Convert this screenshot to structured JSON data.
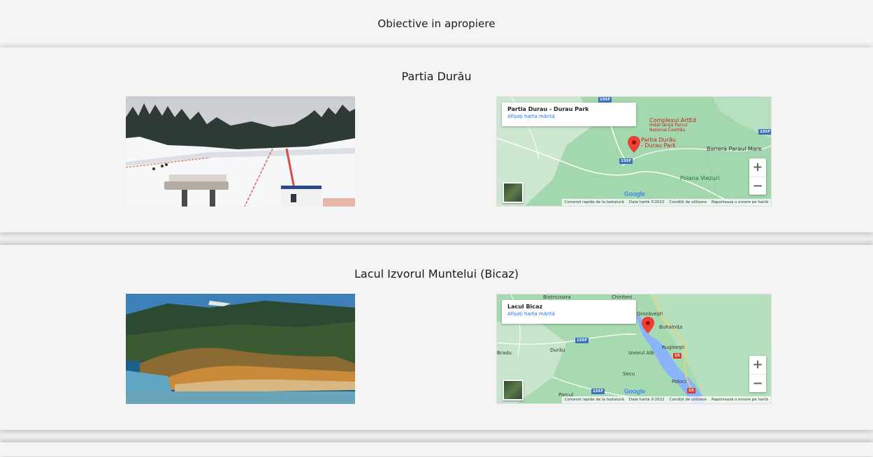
{
  "page_title": "Obiective in apropiere",
  "sections": [
    {
      "title": "Partia Durău",
      "map": {
        "place_name": "Partia Durau - Durau Park",
        "enlarge_link": "Afișați harta mărită",
        "labels": {
          "poi1_title": "Complexul ArtEd",
          "poi1_sub": "Hotel lângă Parcul Național Ceahlău",
          "poi2": "Partia Durău - Durau Park",
          "poi3": "Bariera Paraul Mare",
          "poi4": "Poiana Viezuri",
          "road1": "155F",
          "road2": "155F",
          "road3": "155F"
        },
        "footer": {
          "shortcuts": "Comenzi rapide de la tastatură",
          "map_data": "Date hartă ©2022",
          "terms": "Condiții de utilizare",
          "report": "Raportează o eroare pe hartă"
        }
      }
    },
    {
      "title": "Lacul Izvorul Muntelui (Bicaz)",
      "map": {
        "place_name": "Lacul Bicaz",
        "enlarge_link": "Afișați harta mărită",
        "labels": {
          "l1": "Bistricioara",
          "l2": "Chiriteni",
          "l3": "Grozăvești",
          "l4": "Buhalnița",
          "l5": "Rugineşti",
          "l6": "Bradu",
          "l7": "Durău",
          "l8": "Izvorul Alb",
          "l9": "Secu",
          "l10": "Potoci",
          "l11": "Parcul",
          "road1": "155F",
          "road2": "155F",
          "road3": "15",
          "road4": "15"
        },
        "footer": {
          "shortcuts": "Comenzi rapide de la tastatură",
          "map_data": "Date hartă ©2022",
          "terms": "Condiții de utilizare",
          "report": "Raportează o eroare pe hartă"
        }
      }
    }
  ],
  "map_controls": {
    "zoom_in": "+",
    "zoom_out": "−",
    "google": "Google"
  }
}
